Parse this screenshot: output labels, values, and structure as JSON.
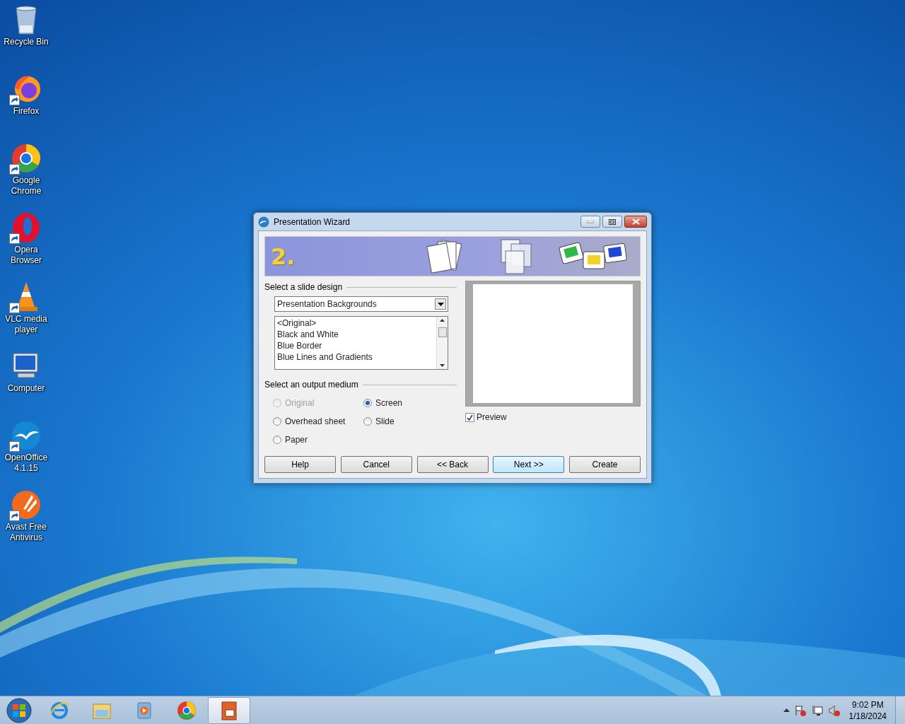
{
  "desktop_icons": [
    {
      "label": "Recycle Bin",
      "shortcut": false
    },
    {
      "label": "Firefox",
      "shortcut": true
    },
    {
      "label": "Google Chrome",
      "shortcut": true
    },
    {
      "label": "Opera Browser",
      "shortcut": true
    },
    {
      "label": "VLC media player",
      "shortcut": true
    },
    {
      "label": "Computer",
      "shortcut": false
    },
    {
      "label": "OpenOffice 4.1.15",
      "shortcut": true
    },
    {
      "label": "Avast Free Antivirus",
      "shortcut": true
    }
  ],
  "window": {
    "title": "Presentation Wizard",
    "step": "2.",
    "design": {
      "heading": "Select a slide design",
      "dropdown": "Presentation Backgrounds",
      "items": [
        "<Original>",
        "Black and White",
        "Blue Border",
        "Blue Lines and Gradients"
      ]
    },
    "medium": {
      "heading": "Select an output medium",
      "options": [
        {
          "label": "Original",
          "selected": false,
          "disabled": true
        },
        {
          "label": "Screen",
          "selected": true,
          "disabled": false
        },
        {
          "label": "Overhead sheet",
          "selected": false,
          "disabled": false
        },
        {
          "label": "Slide",
          "selected": false,
          "disabled": false
        },
        {
          "label": "Paper",
          "selected": false,
          "disabled": false
        }
      ]
    },
    "preview": {
      "label": "Preview",
      "checked": true
    },
    "buttons": [
      {
        "label": "Help",
        "focused": false
      },
      {
        "label": "Cancel",
        "focused": false
      },
      {
        "label": "<< Back",
        "focused": false
      },
      {
        "label": "Next >>",
        "focused": true
      },
      {
        "label": "Create",
        "focused": false
      }
    ]
  },
  "taskbar": {
    "apps": [
      {
        "active": false
      },
      {
        "active": false
      },
      {
        "active": false
      },
      {
        "active": false
      },
      {
        "active": true
      }
    ],
    "time": "9:02 PM",
    "date": "1/18/2024"
  }
}
